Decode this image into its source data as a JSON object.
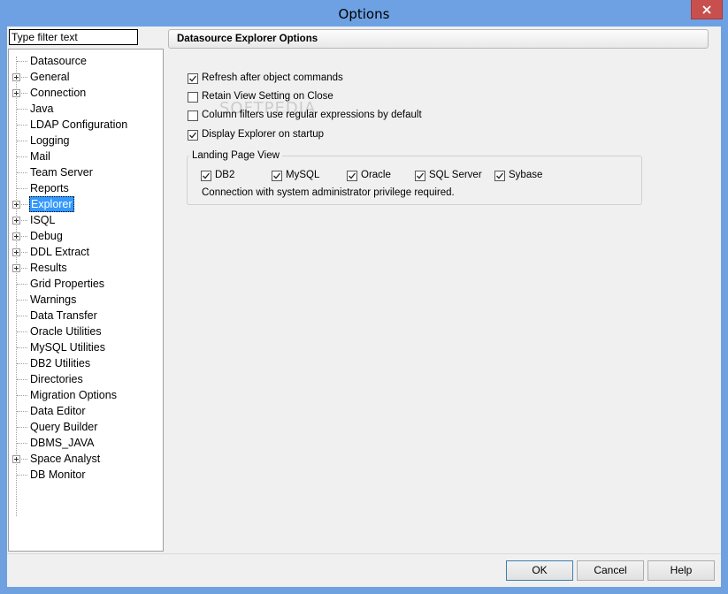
{
  "window": {
    "title": "Options",
    "close_glyph": "✕"
  },
  "filter": {
    "placeholder": "Type filter text",
    "value": ""
  },
  "tree": {
    "items": [
      {
        "label": "Datasource",
        "expandable": false
      },
      {
        "label": "General",
        "expandable": true
      },
      {
        "label": "Connection",
        "expandable": true
      },
      {
        "label": "Java",
        "expandable": false
      },
      {
        "label": "LDAP Configuration",
        "expandable": false
      },
      {
        "label": "Logging",
        "expandable": false
      },
      {
        "label": "Mail",
        "expandable": false
      },
      {
        "label": "Team Server",
        "expandable": false
      },
      {
        "label": "Reports",
        "expandable": false
      },
      {
        "label": "Explorer",
        "expandable": true,
        "selected": true
      },
      {
        "label": "ISQL",
        "expandable": true
      },
      {
        "label": "Debug",
        "expandable": true
      },
      {
        "label": "DDL Extract",
        "expandable": true
      },
      {
        "label": "Results",
        "expandable": true
      },
      {
        "label": "Grid Properties",
        "expandable": false
      },
      {
        "label": "Warnings",
        "expandable": false
      },
      {
        "label": "Data Transfer",
        "expandable": false
      },
      {
        "label": "Oracle Utilities",
        "expandable": false
      },
      {
        "label": "MySQL Utilities",
        "expandable": false
      },
      {
        "label": "DB2 Utilities",
        "expandable": false
      },
      {
        "label": "Directories",
        "expandable": false
      },
      {
        "label": "Migration Options",
        "expandable": false
      },
      {
        "label": "Data Editor",
        "expandable": false
      },
      {
        "label": "Query Builder",
        "expandable": false
      },
      {
        "label": "DBMS_JAVA",
        "expandable": false
      },
      {
        "label": "Space Analyst",
        "expandable": true
      },
      {
        "label": "DB Monitor",
        "expandable": false
      }
    ]
  },
  "panel": {
    "header": "Datasource Explorer Options",
    "options": [
      {
        "label": "Refresh after object commands",
        "checked": true
      },
      {
        "label": "Retain View Setting on Close",
        "checked": false
      },
      {
        "label": "Column filters use regular expressions by default",
        "checked": false
      },
      {
        "label": "Display Explorer on startup",
        "checked": true
      }
    ],
    "landing": {
      "legend": "Landing Page View",
      "platforms": [
        {
          "label": "DB2",
          "checked": true
        },
        {
          "label": "MySQL",
          "checked": true
        },
        {
          "label": "Oracle",
          "checked": true
        },
        {
          "label": "SQL Server",
          "checked": true
        },
        {
          "label": "Sybase",
          "checked": true
        }
      ],
      "note": "Connection with system administrator privilege required."
    },
    "watermark": "SOFTPEDIA"
  },
  "buttons": {
    "ok": "OK",
    "cancel": "Cancel",
    "help": "Help"
  },
  "colors": {
    "titlebar": "#6da1e3",
    "close": "#c7504f",
    "selection": "#3399ff"
  }
}
